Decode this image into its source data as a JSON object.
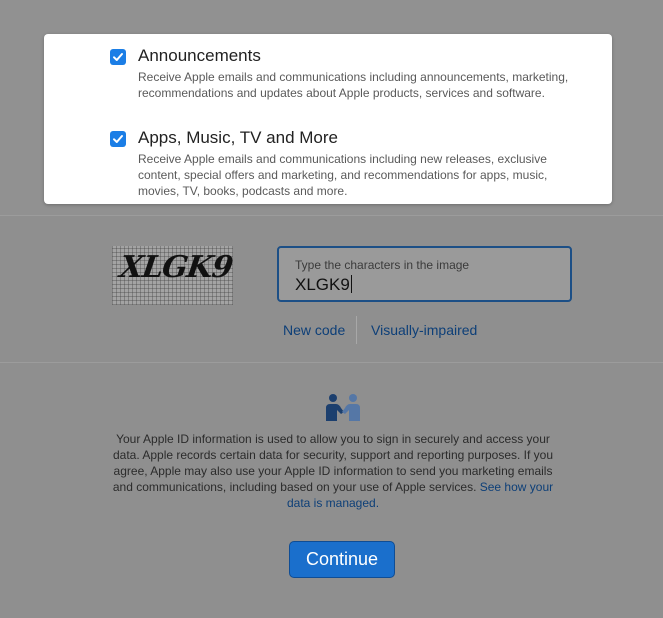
{
  "options": [
    {
      "title": "Announcements",
      "checked": true,
      "description": "Receive Apple emails and communications including announcements, marketing, recommendations and updates about Apple products, services and software."
    },
    {
      "title": "Apps, Music, TV and More",
      "checked": true,
      "description": "Receive Apple emails and communications including new releases, exclusive content, special offers and marketing, and recommendations for apps, music, movies, TV, books, podcasts and more."
    }
  ],
  "captcha": {
    "image_text": "XLGK9",
    "field_label": "Type the characters in the image",
    "field_value": "XLGK9",
    "new_code_label": "New code",
    "visually_impaired_label": "Visually-impaired"
  },
  "privacy": {
    "icon": "handshake-people-icon",
    "text": "Your Apple ID information is used to allow you to sign in securely and access your data. Apple records certain data for security, support and reporting purposes. If you agree, Apple may also use your Apple ID information to send you marketing emails and communications, including based on your use of Apple services. ",
    "link_text": "See how your data is managed."
  },
  "continue_label": "Continue",
  "colors": {
    "accent": "#1b7ee6",
    "button": "#1a6fcc",
    "link": "#0d3f78",
    "overlay": "#8f8f8f"
  }
}
